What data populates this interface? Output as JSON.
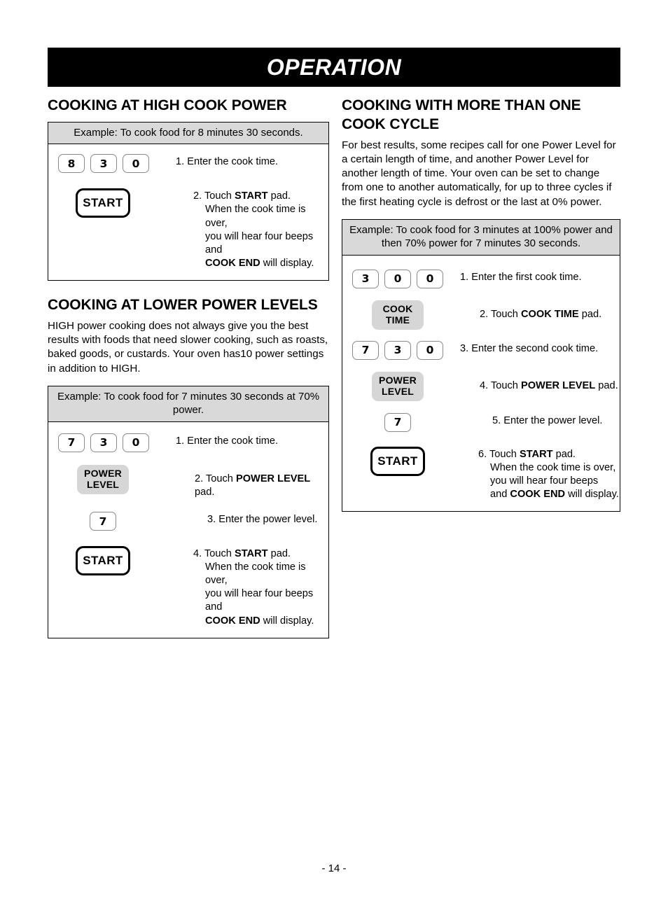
{
  "header": {
    "title": "OPERATION"
  },
  "footer": {
    "page_number": "- 14 -"
  },
  "left_column": {
    "section1": {
      "title": "COOKING AT HIGH COOK POWER",
      "example_header": "Example: To cook food for 8 minutes 30 seconds.",
      "steps": [
        {
          "keys": [
            "8",
            "3",
            "0"
          ],
          "pad_type": "digits",
          "text_number": "1.",
          "text_main": "Enter the cook time.",
          "lines": []
        },
        {
          "keys": [
            "START"
          ],
          "pad_type": "start",
          "text_number": "2.",
          "text_prefix": "Touch ",
          "text_bold": "START",
          "text_suffix": " pad.",
          "lines": [
            {
              "plain_before": "When the cook time is over,",
              "bold": "",
              "plain_after": ""
            },
            {
              "plain_before": "you will hear four beeps and",
              "bold": "",
              "plain_after": ""
            },
            {
              "plain_before": "",
              "bold": "COOK END",
              "plain_after": " will display."
            }
          ]
        }
      ]
    },
    "section2": {
      "title": "COOKING AT LOWER POWER LEVELS",
      "paragraph": "HIGH power cooking does not always give you the best results with foods that need slower cooking, such as roasts, baked goods, or custards. Your oven has10 power settings in addition to HIGH.",
      "example_header": "Example: To cook food for 7 minutes 30 seconds at 70% power.",
      "steps": [
        {
          "keys": [
            "7",
            "3",
            "0"
          ],
          "pad_type": "digits",
          "text_number": "1.",
          "text_main": "Enter the cook time.",
          "lines": []
        },
        {
          "keys": [
            "POWER",
            "LEVEL"
          ],
          "pad_type": "gray",
          "text_number": "2.",
          "text_prefix": "Touch ",
          "text_bold": "POWER LEVEL",
          "text_suffix": " pad.",
          "lines": []
        },
        {
          "keys": [
            "7"
          ],
          "pad_type": "digits",
          "text_number": "3.",
          "text_main": "Enter the power level.",
          "lines": []
        },
        {
          "keys": [
            "START"
          ],
          "pad_type": "start",
          "text_number": "4.",
          "text_prefix": "Touch ",
          "text_bold": "START",
          "text_suffix": " pad.",
          "lines": [
            {
              "plain_before": "When the cook time is over,",
              "bold": "",
              "plain_after": ""
            },
            {
              "plain_before": "you will hear four beeps and",
              "bold": "",
              "plain_after": ""
            },
            {
              "plain_before": "",
              "bold": "COOK END",
              "plain_after": " will display."
            }
          ]
        }
      ]
    }
  },
  "right_column": {
    "section1": {
      "title": "COOKING WITH MORE THAN ONE COOK CYCLE",
      "paragraph": "For best results, some recipes call for one Power Level for a certain length of time, and another Power Level for another length of time. Your oven can be set to change from one to another automatically, for up to three cycles if the first heating cycle is defrost or the last at 0% power.",
      "example_header": "Example: To cook food for 3 minutes at 100% power and then 70% power for 7 minutes 30 seconds.",
      "steps": [
        {
          "keys": [
            "3",
            "0",
            "0"
          ],
          "pad_type": "digits",
          "text_number": "1.",
          "text_main": "Enter the first cook time.",
          "lines": []
        },
        {
          "keys": [
            "COOK",
            "TIME"
          ],
          "pad_type": "gray",
          "text_number": "2.",
          "text_prefix": "Touch ",
          "text_bold": "COOK TIME",
          "text_suffix": " pad.",
          "lines": []
        },
        {
          "keys": [
            "7",
            "3",
            "0"
          ],
          "pad_type": "digits",
          "text_number": "3.",
          "text_main": "Enter the second cook time.",
          "lines": []
        },
        {
          "keys": [
            "POWER",
            "LEVEL"
          ],
          "pad_type": "gray",
          "text_number": "4.",
          "text_prefix": "Touch ",
          "text_bold": "POWER LEVEL",
          "text_suffix": " pad.",
          "lines": []
        },
        {
          "keys": [
            "7"
          ],
          "pad_type": "digits",
          "text_number": "5.",
          "text_main": "Enter the power level.",
          "lines": []
        },
        {
          "keys": [
            "START"
          ],
          "pad_type": "start",
          "text_number": "6.",
          "text_prefix": "Touch ",
          "text_bold": "START",
          "text_suffix": " pad.",
          "lines": [
            {
              "plain_before": "When the cook time is over,",
              "bold": "",
              "plain_after": ""
            },
            {
              "plain_before": "you will hear four beeps",
              "bold": "",
              "plain_after": ""
            },
            {
              "plain_before": "and ",
              "bold": "COOK END",
              "plain_after": " will display."
            }
          ]
        }
      ]
    }
  },
  "colors": {
    "header_bar": "#000000",
    "header_text": "#ffffff",
    "example_header_bg": "#d9d9d9",
    "gray_pad_bg": "#d6d6d6",
    "border": "#000000",
    "digit_key_border": "#8a8a8a"
  }
}
